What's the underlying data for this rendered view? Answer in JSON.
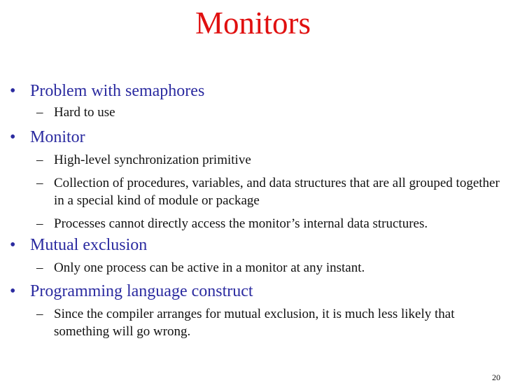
{
  "slide": {
    "title": "Monitors",
    "page_number": "20",
    "bullets": [
      {
        "text": "Problem with semaphores",
        "subs": [
          "Hard to use"
        ]
      },
      {
        "text": "Monitor",
        "subs": [
          "High-level synchronization primitive",
          "Collection of procedures, variables, and data structures that are all grouped together in a special kind of module or package",
          "Processes cannot directly access the monitor’s internal data structures."
        ]
      },
      {
        "text": "Mutual exclusion",
        "subs": [
          "Only one process can be active in a monitor at any instant."
        ]
      },
      {
        "text": "Programming language construct",
        "subs": [
          "Since the compiler arranges for mutual exclusion, it is much less likely that something will go wrong."
        ]
      }
    ],
    "colors": {
      "title": "#e01010",
      "bullet": "#2b2ba0",
      "body": "#111111"
    }
  }
}
